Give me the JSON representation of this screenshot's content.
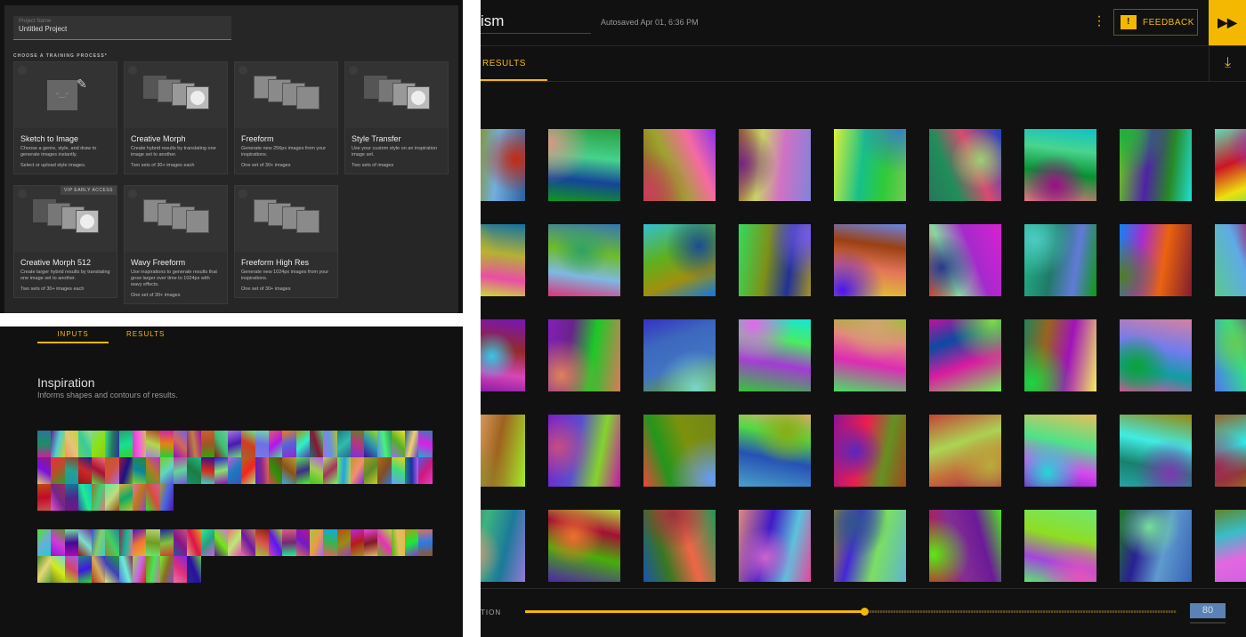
{
  "setup": {
    "project_name_label": "Project Name",
    "project_name_value": "Untitled Project",
    "choose_label": "CHOOSE A TRAINING PROCESS*",
    "processes": [
      {
        "title": "Sketch to Image",
        "desc": "Choose a genre, style, and draw to generate images instantly.",
        "sets": "Select or upload style images.",
        "icon": "sketch"
      },
      {
        "title": "Creative Morph",
        "desc": "Create hybrid results by translating one image set to another.",
        "sets": "Two sets of 30+ images each",
        "icon": "morph"
      },
      {
        "title": "Freeform",
        "desc": "Generate new 256px images from your inspirations.",
        "sets": "One set of 30+ images",
        "icon": "freeform"
      },
      {
        "title": "Style Transfer",
        "desc": "Use your custom style on an inspiration image set.",
        "sets": "Two sets of images",
        "icon": "morph"
      },
      {
        "title": "Creative Morph 512",
        "desc": "Create larger hybrid results by translating one image set to another.",
        "sets": "Two sets of 30+ images each",
        "icon": "morph",
        "badge": "VIP EARLY ACCESS"
      },
      {
        "title": "Wavy Freeform",
        "desc": "Use inspirations to generate results that grow larger over time to 1024px with wavy effects.",
        "sets": "One set of 30+ images",
        "icon": "freeform"
      },
      {
        "title": "Freeform High Res",
        "desc": "Generate new 1024px images from your inspirations.",
        "sets": "One set of 30+ images",
        "icon": "freeform"
      }
    ]
  },
  "inputs": {
    "tabs": [
      "INPUTS",
      "RESULTS"
    ],
    "heading": "Inspiration",
    "subheading": "Informs shapes and contours of results."
  },
  "results": {
    "title": "ism",
    "autosaved": "Autosaved Apr 01, 6:36 PM",
    "feedback_label": "FEEDBACK",
    "tab_label": "RESULTS",
    "slider_label": "TION",
    "slider_value": "80",
    "slider_fraction": 0.52,
    "accent": "#f5b800"
  }
}
